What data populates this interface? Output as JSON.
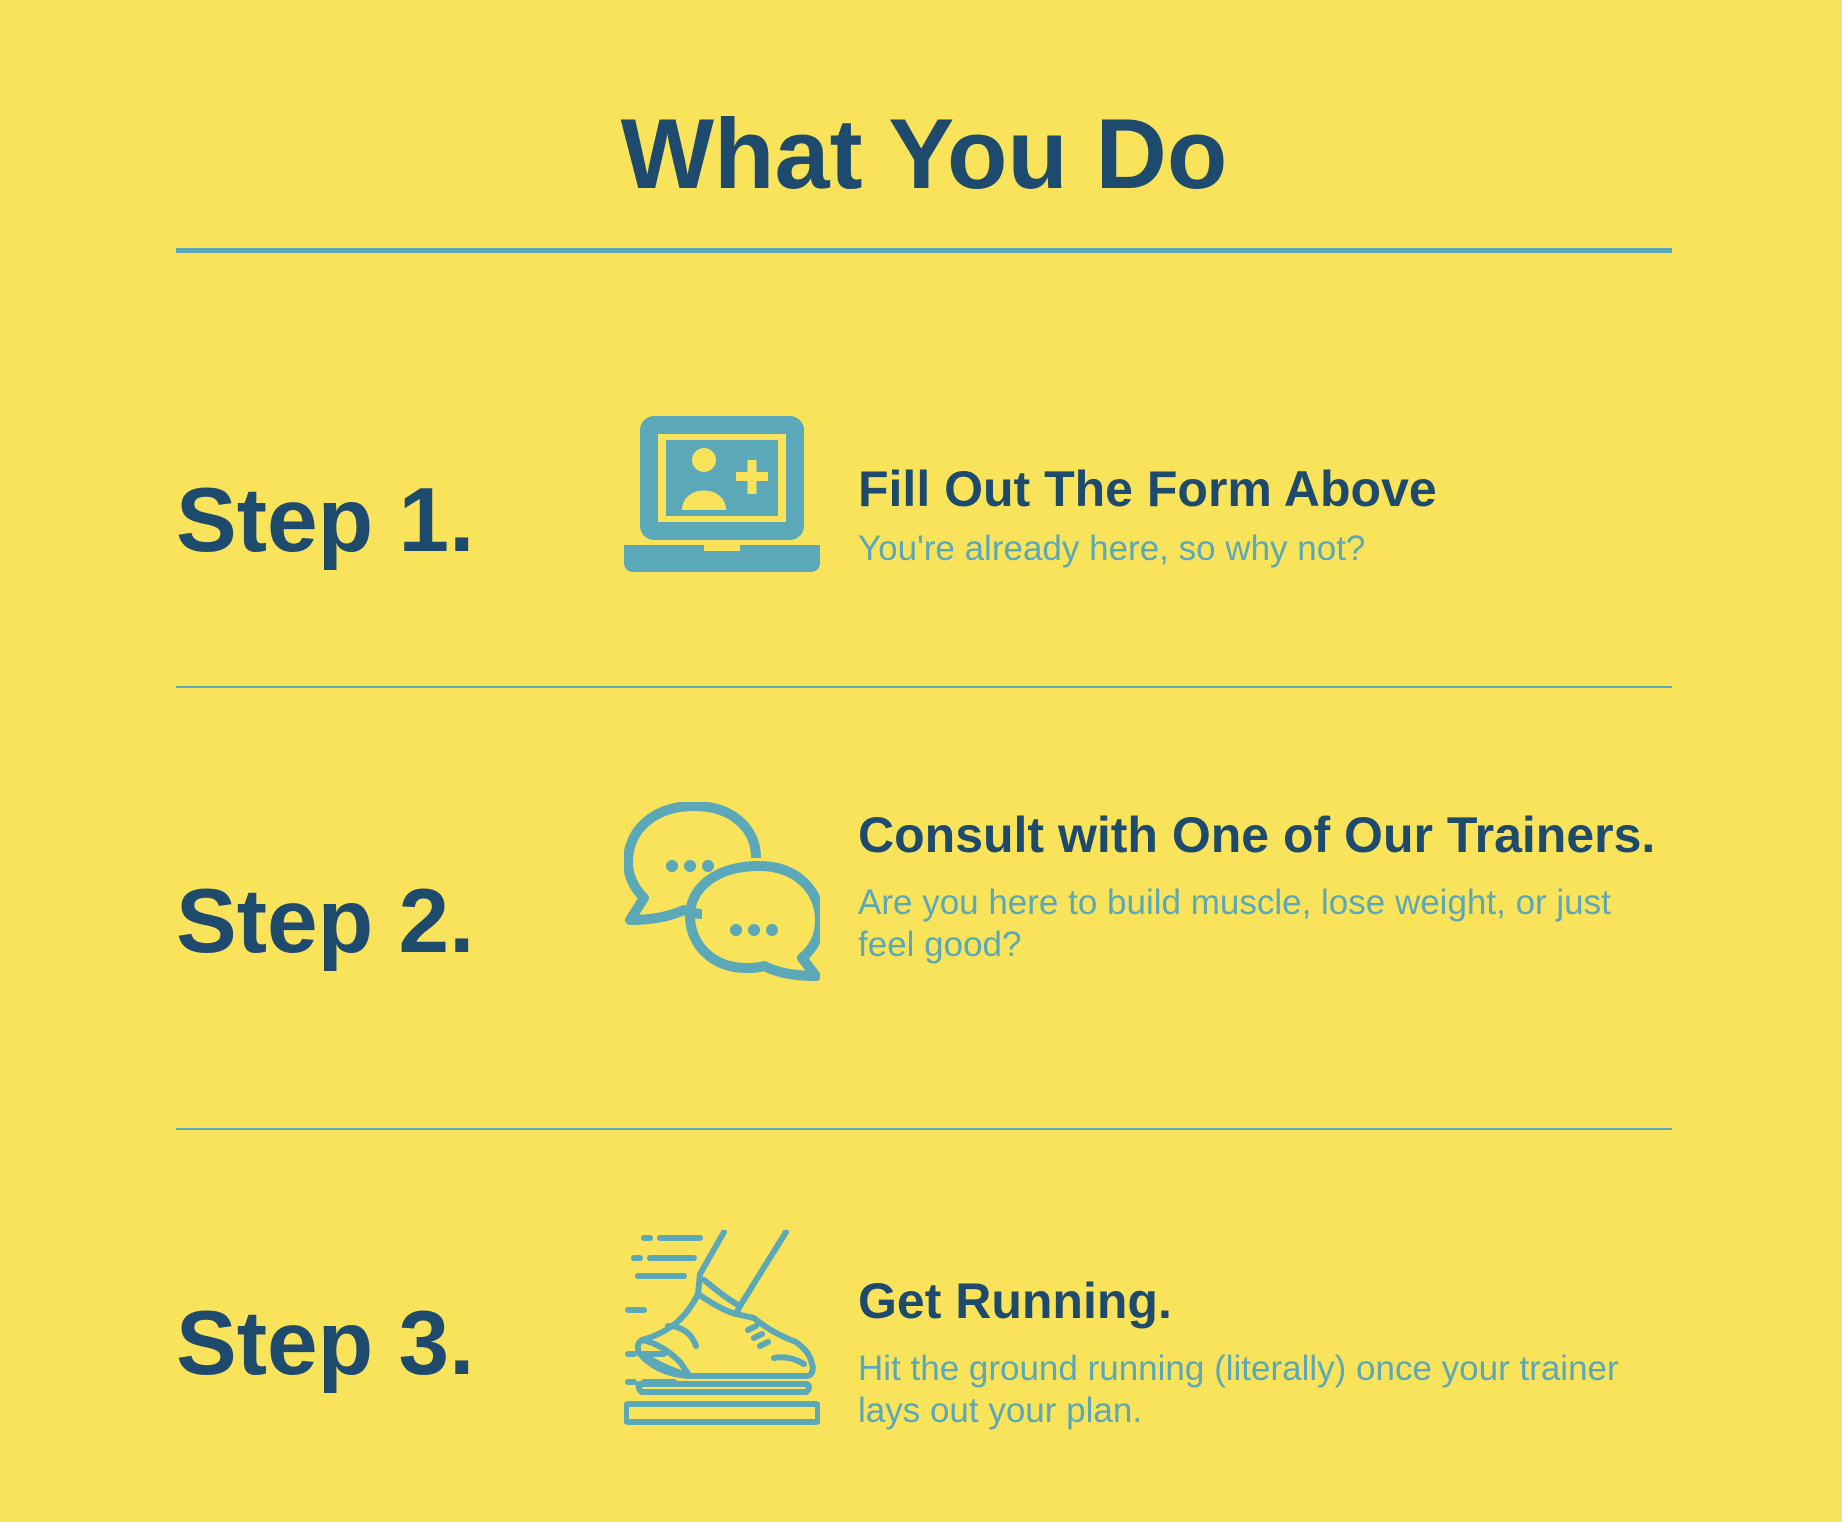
{
  "page": {
    "title": "What You Do"
  },
  "steps": [
    {
      "label": "Step 1.",
      "icon": "laptop-user-plus-icon",
      "heading": "Fill Out The Form Above",
      "description": "You're already here, so why not?"
    },
    {
      "label": "Step 2.",
      "icon": "chat-bubbles-icon",
      "heading": "Consult with One of Our Trainers.",
      "description": "Are you here to build muscle, lose weight, or just feel good?"
    },
    {
      "label": "Step 3.",
      "icon": "running-shoe-icon",
      "heading": "Get Running.",
      "description": "Hit the ground running (literally) once your trainer lays out your plan."
    }
  ],
  "colors": {
    "background": "#F9E35B",
    "primary_text": "#1E4A6E",
    "accent": "#5AA8B8"
  }
}
